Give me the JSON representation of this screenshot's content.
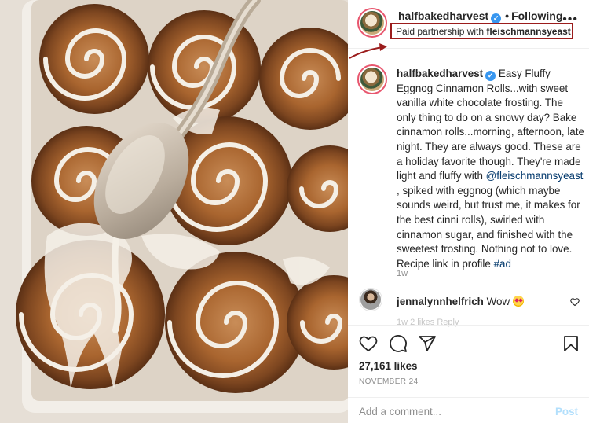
{
  "post": {
    "username": "halfbakedharvest",
    "verified_icon": "verified-badge-icon",
    "separator": "•",
    "follow_status": "Following",
    "partnership_prefix": "Paid partnership with ",
    "partner": "fleischmannsyeast",
    "more_icon": "more-options-icon"
  },
  "caption": {
    "username": "halfbakedharvest",
    "text_1": "Easy Fluffy Eggnog Cinnamon Rolls...with sweet vanilla white chocolate frosting. The only thing to do on a snowy day? Bake cinnamon rolls...morning, afternoon, late night. They are always good. These are a holiday favorite though. They're made light and fluffy with ",
    "mention": "@fleischmannsyeast",
    "text_2": " , spiked with eggnog (which maybe sounds weird, but trust me, it makes for the best cinni rolls), swirled with cinnamon sugar, and finished with the sweetest frosting. Nothing not to love. Recipe link in profile ",
    "hashtag": "#ad",
    "time": "1w"
  },
  "comment": {
    "username": "jennalynnhelfrich",
    "text": "Wow",
    "emoji": "heart-eyes-emoji",
    "faded_text": "1w  2 likes  Reply"
  },
  "actions": {
    "icons": [
      "heart-icon",
      "comment-icon",
      "share-icon",
      "bookmark-icon"
    ],
    "likes": "27,161 likes",
    "date": "NOVEMBER 24"
  },
  "add_comment": {
    "placeholder": "Add a comment...",
    "post_label": "Post"
  },
  "colors": {
    "highlight_box": "#9b1c1c",
    "link": "#00376b",
    "verified": "#3897f0",
    "post_button_disabled": "#b2dffc",
    "story_ring": "#e8566e"
  }
}
